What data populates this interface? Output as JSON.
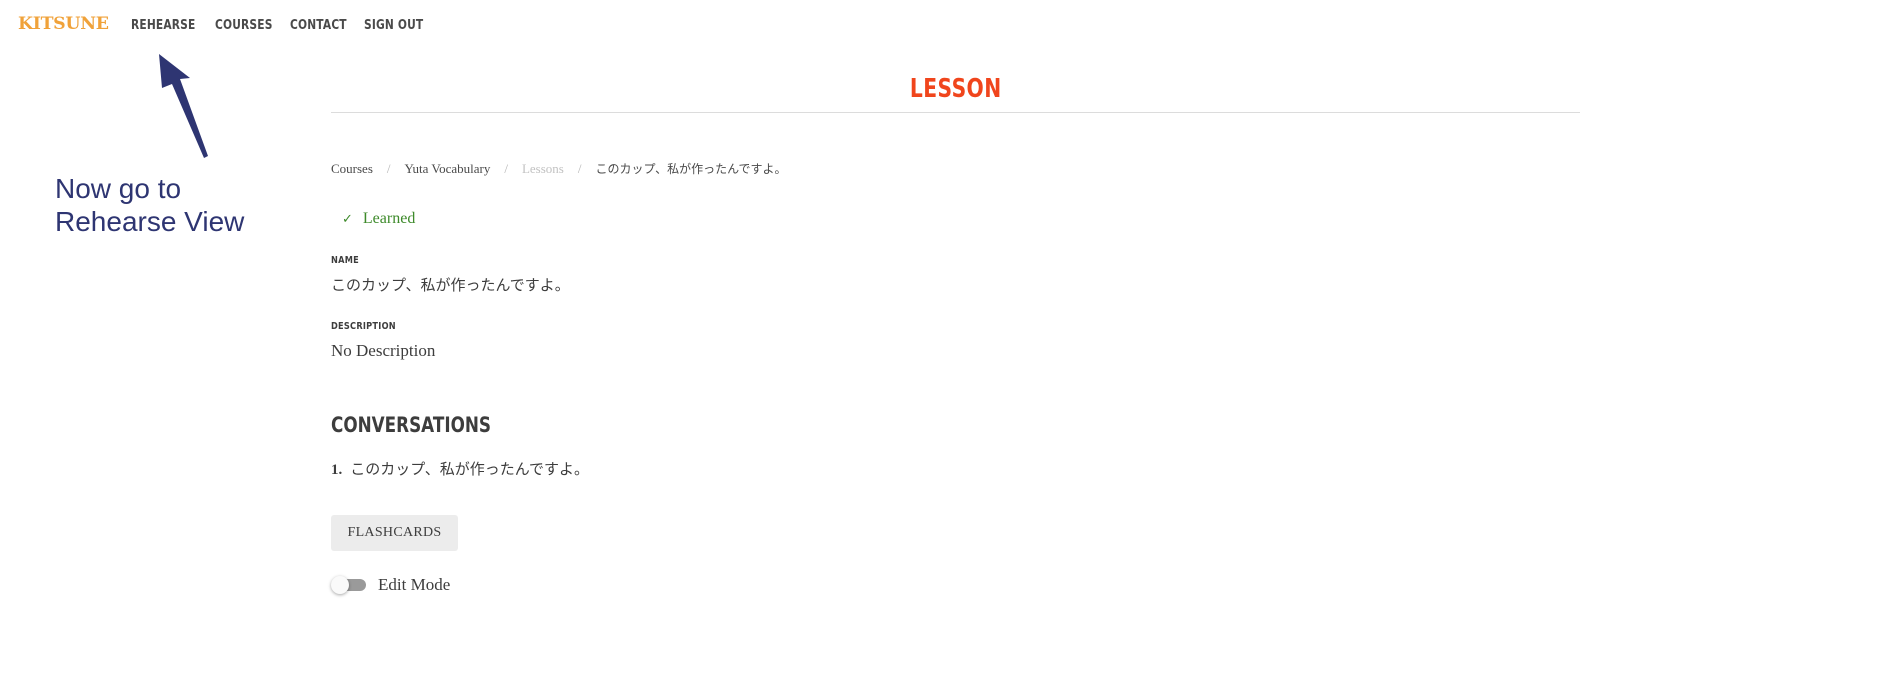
{
  "header": {
    "logo": "KITSUNE",
    "nav": [
      "REHEARSE",
      "COURSES",
      "CONTACT",
      "SIGN OUT"
    ]
  },
  "annotation": {
    "line1": "Now go to",
    "line2": "Rehearse View",
    "color": "#2e3572"
  },
  "page": {
    "title": "LESSON",
    "title_color": "#f0451c"
  },
  "breadcrumb": {
    "items": [
      "Courses",
      "Yuta Vocabulary",
      "Lessons",
      "このカップ、私が作ったんですよ。"
    ],
    "separator": "/"
  },
  "status": {
    "icon": "check-icon",
    "label": "Learned",
    "color": "#3d8a2a"
  },
  "fields": {
    "name_label": "NAME",
    "name_value": "このカップ、私が作ったんですよ。",
    "description_label": "DESCRIPTION",
    "description_value": "No Description"
  },
  "conversations": {
    "heading": "CONVERSATIONS",
    "items": [
      {
        "number": "1.",
        "text": "このカップ、私が作ったんですよ。"
      }
    ]
  },
  "actions": {
    "flashcards_label": "FLASHCARDS",
    "edit_mode_label": "Edit Mode",
    "edit_mode_on": false
  }
}
